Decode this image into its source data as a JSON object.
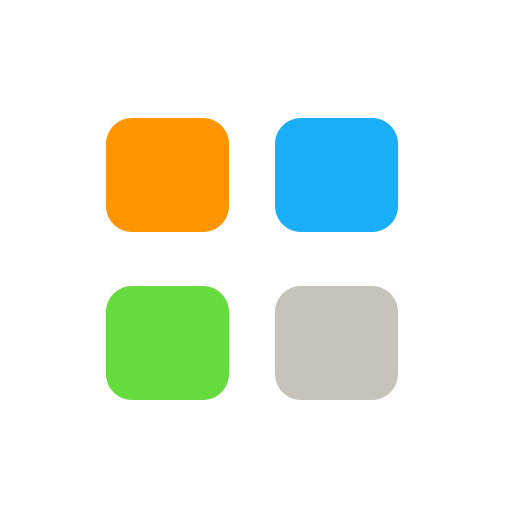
{
  "icon": {
    "name": "app-grid-icon",
    "tiles": [
      {
        "name": "orange-tile",
        "color": "#FF9500"
      },
      {
        "name": "blue-tile",
        "color": "#1AAEF7"
      },
      {
        "name": "green-tile",
        "color": "#65DB3D"
      },
      {
        "name": "gray-tile",
        "color": "#C6C3BD"
      }
    ]
  }
}
